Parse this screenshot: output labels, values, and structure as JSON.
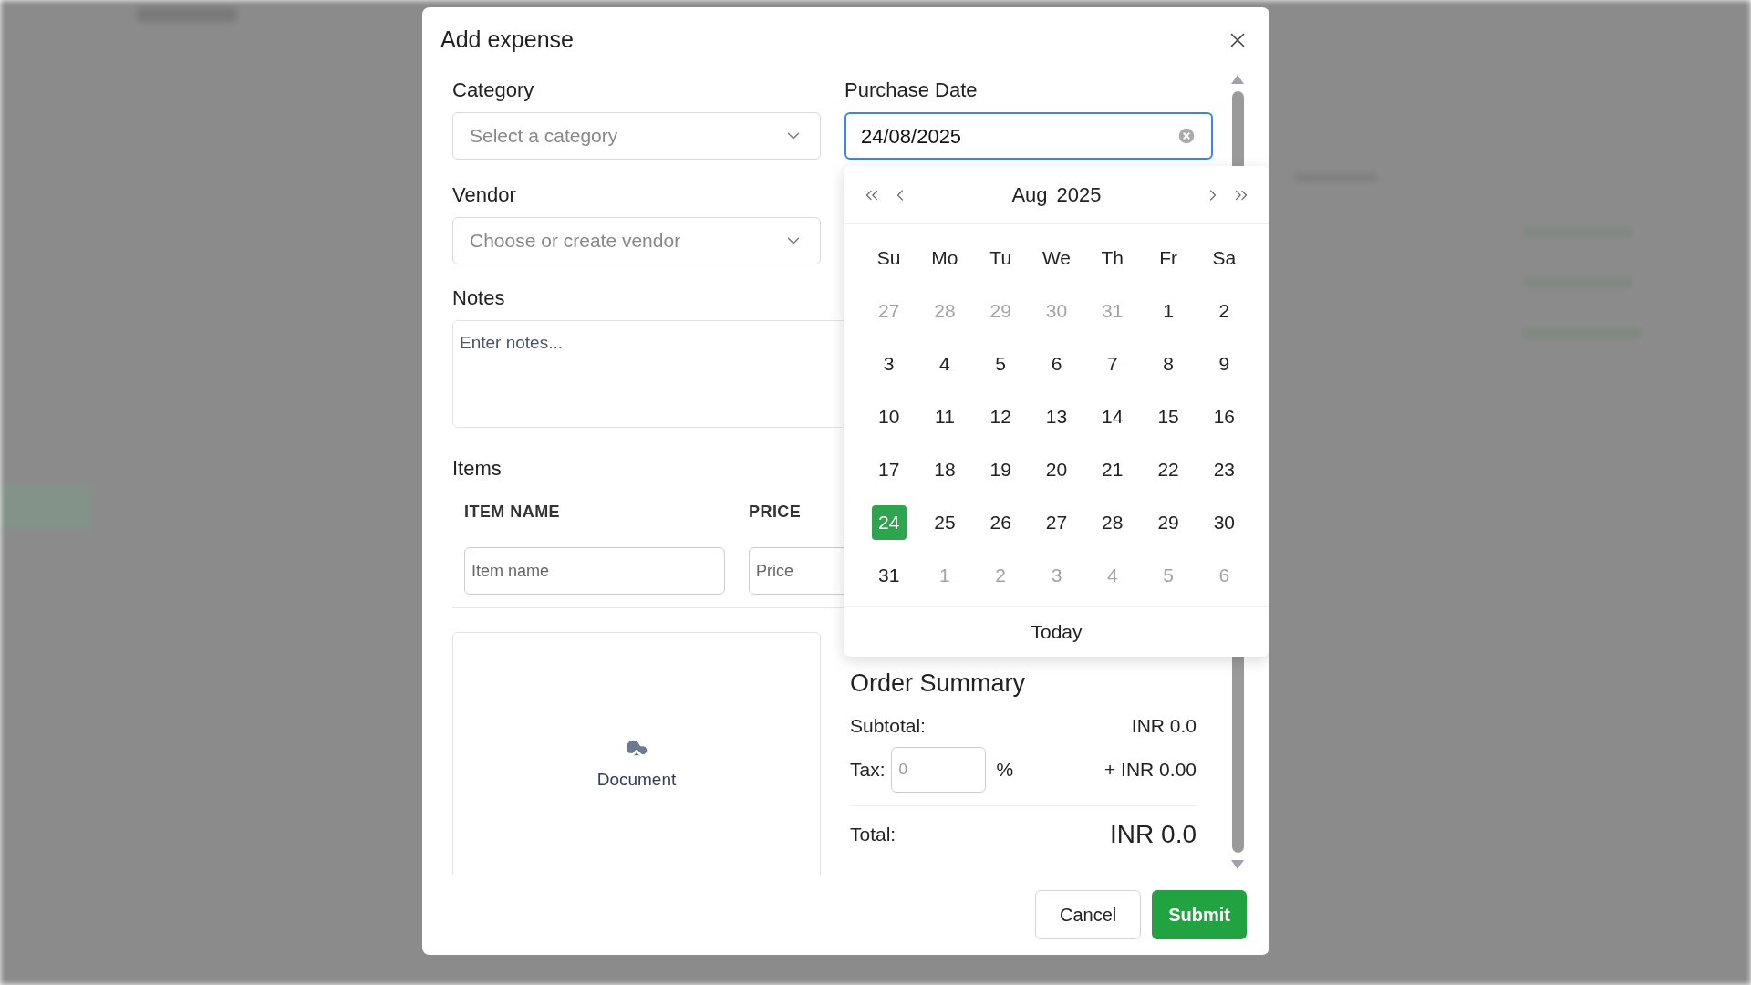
{
  "modal": {
    "title": "Add expense"
  },
  "form": {
    "category": {
      "label": "Category",
      "placeholder": "Select a category"
    },
    "purchase_date": {
      "label": "Purchase Date",
      "value": "24/08/2025"
    },
    "vendor": {
      "label": "Vendor",
      "placeholder": "Choose or create vendor"
    },
    "notes": {
      "label": "Notes",
      "placeholder": "Enter notes..."
    },
    "items": {
      "label": "Items",
      "columns": [
        "ITEM NAME",
        "PRICE"
      ],
      "item_placeholder": "Item name",
      "price_placeholder": "Price"
    },
    "document": {
      "label": "Document"
    },
    "order_summary": {
      "title": "Order Summary",
      "subtotal_label": "Subtotal:",
      "subtotal_value": "INR 0.0",
      "tax_label": "Tax:",
      "tax_placeholder": "0",
      "tax_unit": "%",
      "tax_amount": "+ INR 0.00",
      "total_label": "Total:",
      "total_value": "INR 0.0"
    }
  },
  "calendar": {
    "month": "Aug",
    "year": "2025",
    "weekdays": [
      "Su",
      "Mo",
      "Tu",
      "We",
      "Th",
      "Fr",
      "Sa"
    ],
    "days": [
      {
        "label": "27",
        "outside": true,
        "selected": false
      },
      {
        "label": "28",
        "outside": true,
        "selected": false
      },
      {
        "label": "29",
        "outside": true,
        "selected": false
      },
      {
        "label": "30",
        "outside": true,
        "selected": false
      },
      {
        "label": "31",
        "outside": true,
        "selected": false
      },
      {
        "label": "1",
        "outside": false,
        "selected": false
      },
      {
        "label": "2",
        "outside": false,
        "selected": false
      },
      {
        "label": "3",
        "outside": false,
        "selected": false
      },
      {
        "label": "4",
        "outside": false,
        "selected": false
      },
      {
        "label": "5",
        "outside": false,
        "selected": false
      },
      {
        "label": "6",
        "outside": false,
        "selected": false
      },
      {
        "label": "7",
        "outside": false,
        "selected": false
      },
      {
        "label": "8",
        "outside": false,
        "selected": false
      },
      {
        "label": "9",
        "outside": false,
        "selected": false
      },
      {
        "label": "10",
        "outside": false,
        "selected": false
      },
      {
        "label": "11",
        "outside": false,
        "selected": false
      },
      {
        "label": "12",
        "outside": false,
        "selected": false
      },
      {
        "label": "13",
        "outside": false,
        "selected": false
      },
      {
        "label": "14",
        "outside": false,
        "selected": false
      },
      {
        "label": "15",
        "outside": false,
        "selected": false
      },
      {
        "label": "16",
        "outside": false,
        "selected": false
      },
      {
        "label": "17",
        "outside": false,
        "selected": false
      },
      {
        "label": "18",
        "outside": false,
        "selected": false
      },
      {
        "label": "19",
        "outside": false,
        "selected": false
      },
      {
        "label": "20",
        "outside": false,
        "selected": false
      },
      {
        "label": "21",
        "outside": false,
        "selected": false
      },
      {
        "label": "22",
        "outside": false,
        "selected": false
      },
      {
        "label": "23",
        "outside": false,
        "selected": false
      },
      {
        "label": "24",
        "outside": false,
        "selected": true
      },
      {
        "label": "25",
        "outside": false,
        "selected": false
      },
      {
        "label": "26",
        "outside": false,
        "selected": false
      },
      {
        "label": "27",
        "outside": false,
        "selected": false
      },
      {
        "label": "28",
        "outside": false,
        "selected": false
      },
      {
        "label": "29",
        "outside": false,
        "selected": false
      },
      {
        "label": "30",
        "outside": false,
        "selected": false
      },
      {
        "label": "31",
        "outside": false,
        "selected": false
      },
      {
        "label": "1",
        "outside": true,
        "selected": false
      },
      {
        "label": "2",
        "outside": true,
        "selected": false
      },
      {
        "label": "3",
        "outside": true,
        "selected": false
      },
      {
        "label": "4",
        "outside": true,
        "selected": false
      },
      {
        "label": "5",
        "outside": true,
        "selected": false
      },
      {
        "label": "6",
        "outside": true,
        "selected": false
      }
    ],
    "today": "Today"
  },
  "buttons": {
    "cancel": "Cancel",
    "submit": "Submit"
  }
}
